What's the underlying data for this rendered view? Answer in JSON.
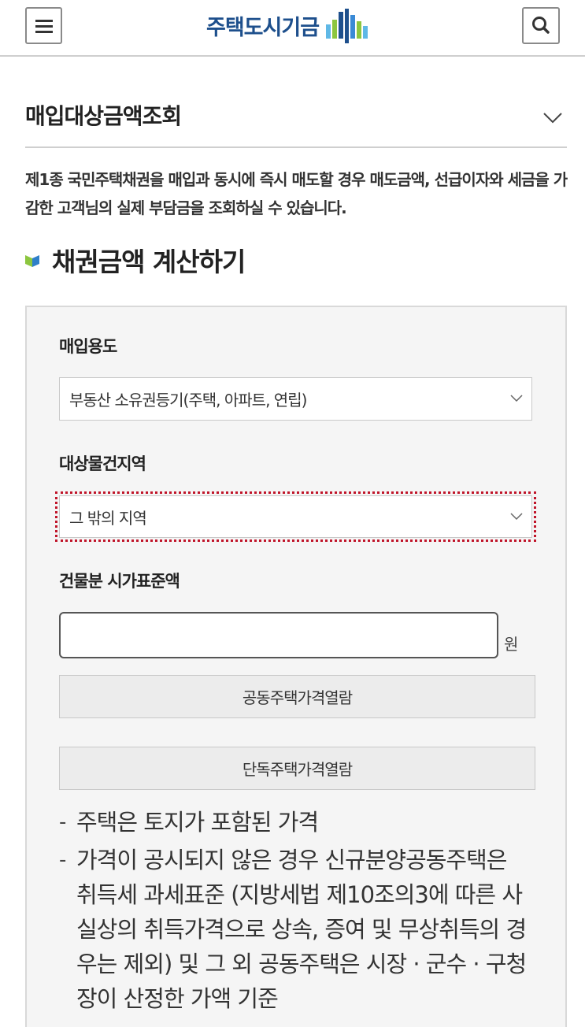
{
  "header": {
    "logo_text": "주택도시기금",
    "menu_icon": "hamburger-menu-icon",
    "search_icon": "search-icon",
    "brand_color": "#1d4f8c"
  },
  "section": {
    "title": "매입대상금액조회",
    "intro": "제1종 국민주택채권을 매입과 동시에 즉시 매도할 경우 매도금액, 선급이자와 세금을 가감한 고객님의 실제 부담금을 조회하실 수 있습니다."
  },
  "calculator": {
    "heading": "채권금액 계산하기",
    "purpose": {
      "label": "매입용도",
      "selected": "부동산 소유권등기(주택, 아파트, 연립)"
    },
    "region": {
      "label": "대상물건지역",
      "selected": "그 밖의 지역"
    },
    "building_value": {
      "label": "건물분 시가표준액",
      "value": "",
      "unit": "원"
    },
    "buttons": {
      "apartment_price": "공동주택가격열람",
      "house_price": "단독주택가격열람"
    },
    "notes": [
      "주택은 토지가 포함된 가격",
      "가격이 공시되지 않은 경우 신규분양공동주택은 취득세 과세표준 (지방세법 제10조의3에 따른 사실상의 취득가격으로 상속, 증여 및 무상취득의 경우는 제외) 및 그 외 공동주택은 시장 · 군수 · 구청장이 산정한 가액 기준"
    ]
  }
}
